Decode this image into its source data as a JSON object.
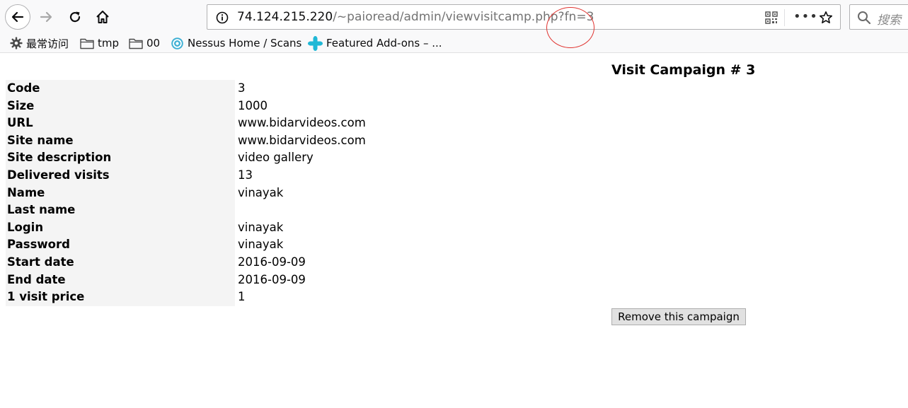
{
  "browser": {
    "url_host": "74.124.215.220",
    "url_path": "/~paioread/admin/viewvisitcamp.php?fn=3",
    "search_placeholder": "搜索",
    "menu_dots": "•••",
    "bookmarks": [
      {
        "label": "最常访问",
        "icon": "gear-icon"
      },
      {
        "label": "tmp",
        "icon": "folder-icon"
      },
      {
        "label": "00",
        "icon": "folder-icon"
      },
      {
        "label": "Nessus Home / Scans",
        "icon": "nessus-icon"
      },
      {
        "label": "Featured Add-ons – ...",
        "icon": "puzzle-icon"
      }
    ]
  },
  "page": {
    "title": "Visit Campaign # 3",
    "rows": [
      {
        "label": "Code",
        "value": "3"
      },
      {
        "label": "Size",
        "value": "1000"
      },
      {
        "label": "URL",
        "value": "www.bidarvideos.com"
      },
      {
        "label": "Site name",
        "value": "www.bidarvideos.com"
      },
      {
        "label": "Site description",
        "value": "video gallery"
      },
      {
        "label": "Delivered visits",
        "value": "13"
      },
      {
        "label": "Name",
        "value": "vinayak"
      },
      {
        "label": "Last name",
        "value": ""
      },
      {
        "label": "Login",
        "value": "vinayak"
      },
      {
        "label": "Password",
        "value": "vinayak"
      },
      {
        "label": "Start date",
        "value": "2016-09-09"
      },
      {
        "label": "End date",
        "value": "2016-09-09"
      },
      {
        "label": "1 visit price",
        "value": "1"
      }
    ],
    "remove_button": "Remove this campaign"
  },
  "colors": {
    "annotation": "#e0332f",
    "label_cell_bg": "#f4f4f4"
  }
}
